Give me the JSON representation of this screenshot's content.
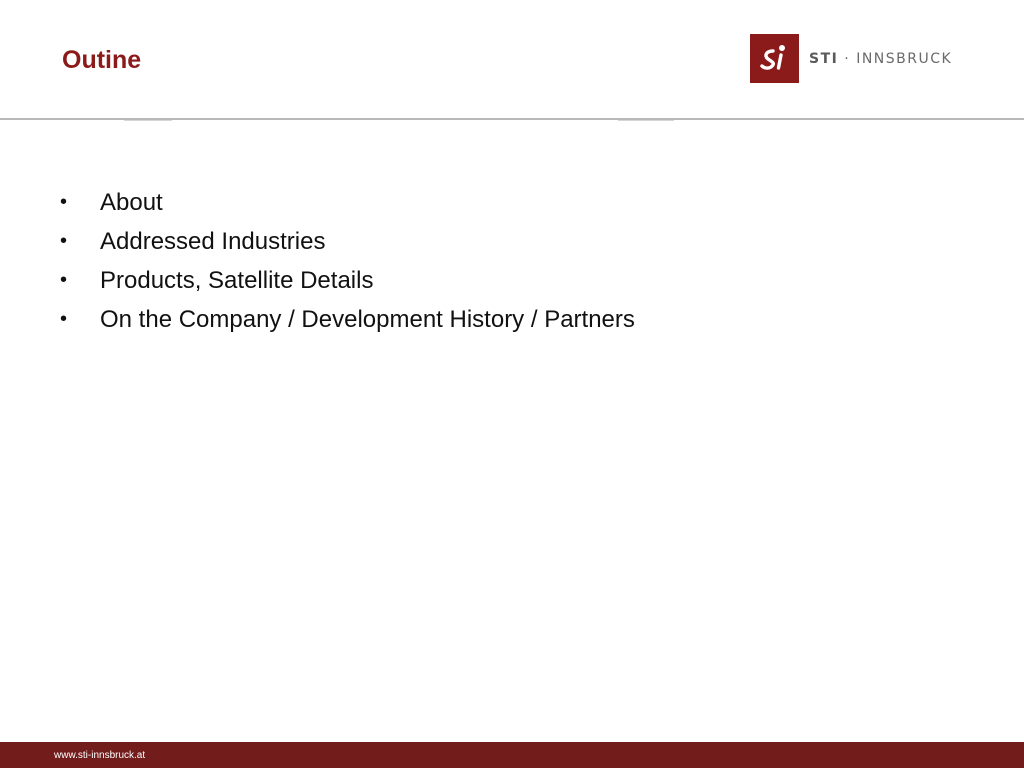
{
  "header": {
    "title": "Outine",
    "logo_text_strong": "STI",
    "logo_text_rest": " · INNSBRUCK",
    "accent_color": "#8b1a1a"
  },
  "content": {
    "bullets": [
      "About",
      "Addressed Industries",
      "Products, Satellite Details",
      "On the Company / Development History / Partners"
    ],
    "bullet_symbol": "•"
  },
  "footer": {
    "url": "www.sti-innsbruck.at",
    "color": "#731c1c"
  }
}
